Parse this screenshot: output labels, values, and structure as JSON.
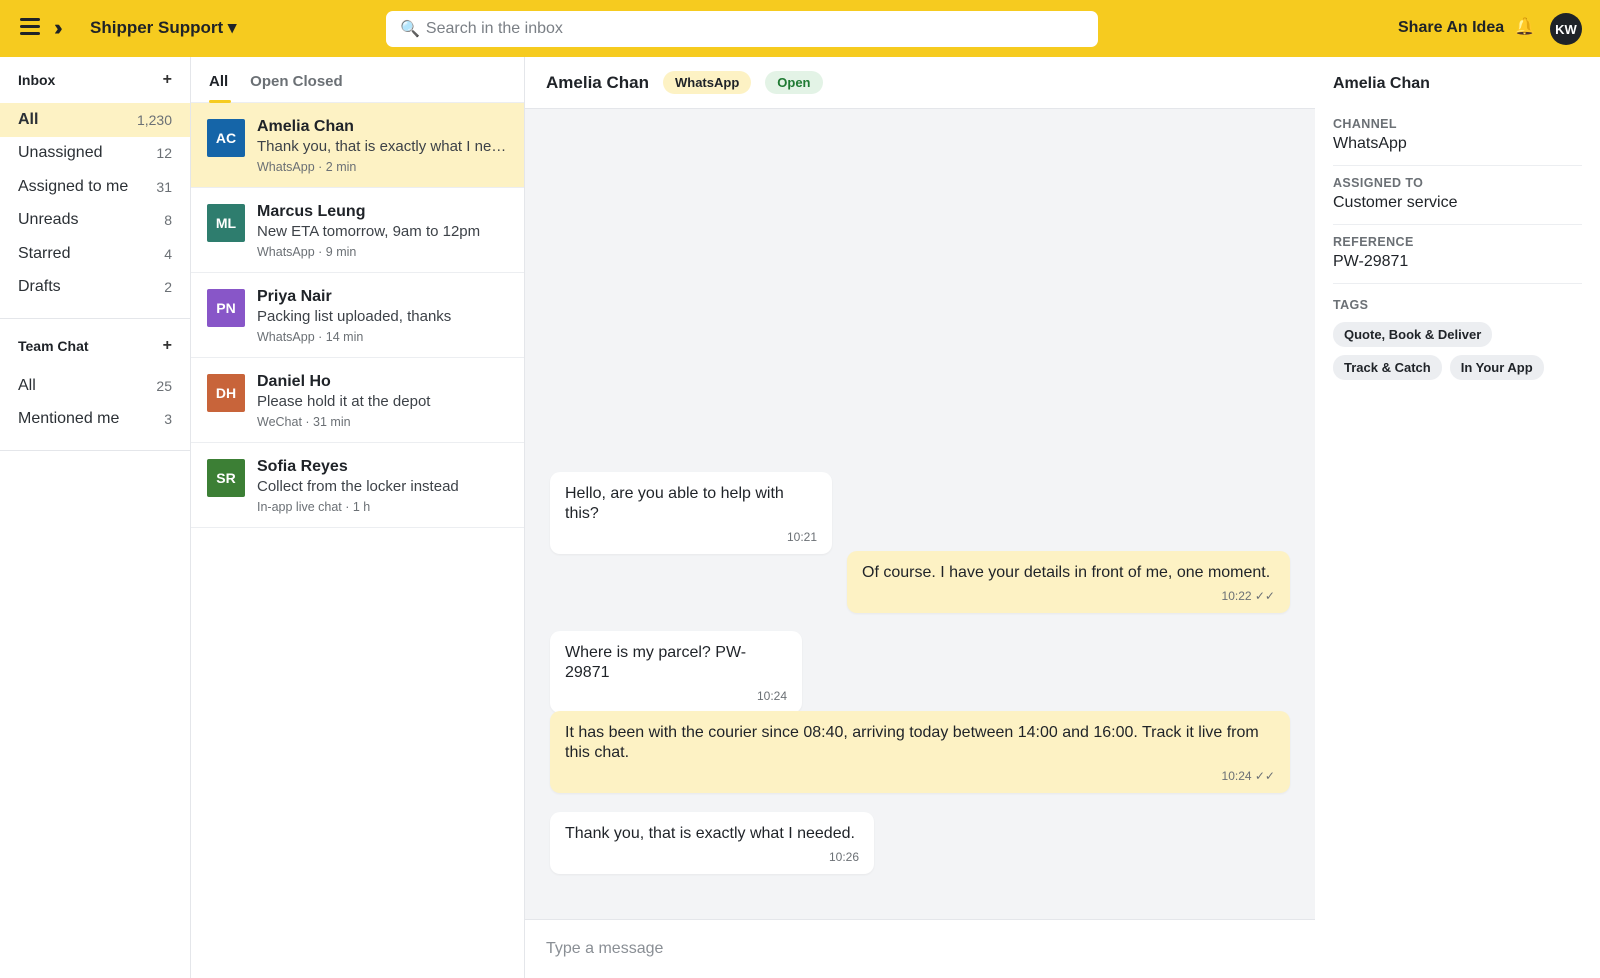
{
  "topbar": {
    "workspace": "Shipper Support ▾",
    "search_placeholder": "Search in the inbox",
    "share_idea": "Share An Idea",
    "user_initials": "KW"
  },
  "nav": {
    "inbox_title": "Inbox",
    "inbox_items": [
      {
        "label": "All",
        "count": "1,230"
      },
      {
        "label": "Unassigned",
        "count": "12"
      },
      {
        "label": "Assigned to me",
        "count": "31"
      },
      {
        "label": "Unreads",
        "count": "8"
      },
      {
        "label": "Starred",
        "count": "4"
      },
      {
        "label": "Drafts",
        "count": "2"
      }
    ],
    "team_title": "Team Chat",
    "team_items": [
      {
        "label": "All",
        "count": "25"
      },
      {
        "label": "Mentioned me",
        "count": "3"
      }
    ]
  },
  "list": {
    "tabs": [
      "All",
      "Open Closed"
    ],
    "conversations": [
      {
        "initials": "AC",
        "color": "#1565a8",
        "name": "Amelia Chan",
        "preview": "Thank you, that is exactly what I needed.",
        "meta": "WhatsApp · 2 min"
      },
      {
        "initials": "ML",
        "color": "#2e7d6e",
        "name": "Marcus Leung",
        "preview": "New ETA tomorrow, 9am to 12pm",
        "meta": "WhatsApp · 9 min"
      },
      {
        "initials": "PN",
        "color": "#8856c8",
        "name": "Priya Nair",
        "preview": "Packing list uploaded, thanks",
        "meta": "WhatsApp · 14 min"
      },
      {
        "initials": "DH",
        "color": "#c8643a",
        "name": "Daniel Ho",
        "preview": "Please hold it at the depot",
        "meta": "WeChat · 31 min"
      },
      {
        "initials": "SR",
        "color": "#3c7f35",
        "name": "Sofia Reyes",
        "preview": "Collect from the locker instead",
        "meta": "In-app live chat · 1 h"
      }
    ]
  },
  "chat": {
    "name": "Amelia Chan",
    "channel": "WhatsApp",
    "status": "Open",
    "messages": [
      {
        "text": "Hello, are you able to help with this?",
        "time": "10:21"
      },
      {
        "text": "Of course. I have your details in front of me, one moment.",
        "time": "10:22 ✓✓"
      },
      {
        "text": "Where is my parcel? PW-29871",
        "time": "10:24"
      },
      {
        "text": "It has been with the courier since 08:40, arriving today between 14:00 and 16:00. Track it live from this chat.",
        "time": "10:24 ✓✓"
      },
      {
        "text": "Thank you, that is exactly what I needed.",
        "time": "10:26"
      }
    ],
    "composer_placeholder": "Type a message"
  },
  "details": {
    "name": "Amelia Chan",
    "channel_label": "CHANNEL",
    "channel_value": "WhatsApp",
    "assigned_label": "ASSIGNED TO",
    "assigned_value": "Customer service",
    "reference_label": "REFERENCE",
    "reference_value": "PW-29871",
    "tags_label": "TAGS",
    "tags": [
      "Quote, Book & Deliver",
      "Track & Catch",
      "In Your App"
    ]
  }
}
